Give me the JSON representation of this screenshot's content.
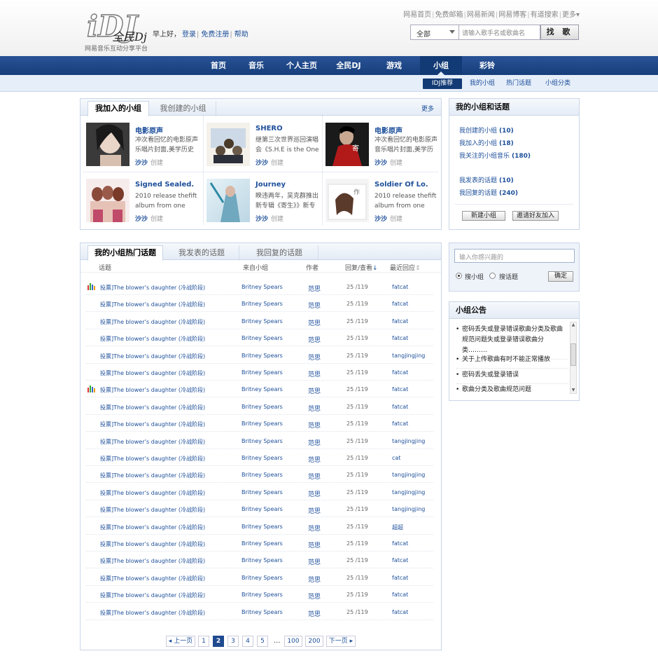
{
  "header": {
    "logo_text": "全民Dj",
    "logo_sub": "网易音乐互动分享平台",
    "greeting": "早上好，",
    "login": "登录",
    "register": "免费注册",
    "help": "帮助",
    "top_links": [
      "网易首页",
      "免费邮箱",
      "网易新闻",
      "网易博客",
      "有道搜索",
      "更多▾"
    ]
  },
  "search": {
    "category": "全部",
    "placeholder": "请输入歌手名或歌曲名",
    "button": "找 歌"
  },
  "nav": {
    "items": [
      "首页",
      "音乐",
      "个人主页",
      "全民DJ",
      "游戏",
      "小组",
      "彩铃"
    ],
    "active": "小组"
  },
  "subnav": {
    "items": [
      "IDJ推荐",
      "我的小组",
      "热门话题",
      "小组分类"
    ]
  },
  "my_groups": {
    "tabs": [
      "我加入的小组",
      "我创建的小组"
    ],
    "more": "更多",
    "groups": [
      {
        "title": "电影原声",
        "desc": "冲次看回忆的电影原声乐唱片封面,美学历史",
        "author": "沙沙",
        "created": "创建"
      },
      {
        "title": "SHERO",
        "desc": "继第三次世界巡回演唱会《S.H.E is the One",
        "author": "沙沙",
        "created": "创建"
      },
      {
        "title": "电影原声",
        "desc": "冲次看回忆的电影原声音乐唱片封面,美学历史",
        "author": "沙沙",
        "created": "创建"
      },
      {
        "title": "Signed Sealed.",
        "desc": "2010 release thefift album from one",
        "author": "沙沙",
        "created": "创建"
      },
      {
        "title": "Journey",
        "desc": "睽违两年，吴克群推出新专辑《寄生》》新专",
        "author": "沙沙",
        "created": "创建"
      },
      {
        "title": "Soldier Of Lo.",
        "desc": "2010 release thefift album from one",
        "author": "沙沙",
        "created": "创建"
      }
    ]
  },
  "side_box": {
    "title": "我的小组和话题",
    "links": [
      {
        "label": "我创建的小组",
        "count": "(10)"
      },
      {
        "label": "我加入的小组",
        "count": "(18)"
      },
      {
        "label": "我关注的小组音乐",
        "count": "(180)"
      },
      {
        "label": "我发表的话题",
        "count": "(10)"
      },
      {
        "label": "我回复的话题",
        "count": "(240)"
      }
    ],
    "btn_new": "新建小组",
    "btn_invite": "邀请好友加入"
  },
  "topics": {
    "tabs": [
      "我的小组热门话题",
      "我发表的话题",
      "我回复的话题"
    ],
    "headers": {
      "topic": "话题",
      "from": "来自小组",
      "author": "作者",
      "reply": "回复/查看",
      "last": "最近回应"
    },
    "rows": [
      {
        "hot": true,
        "topic": "投票]The blower’s daughter (冷战阶段)",
        "from": "Britney Spears",
        "author": "范思",
        "rv": "25 /119",
        "last": "fatcat"
      },
      {
        "hot": false,
        "topic": "投票]The blower’s daughter (冷战阶段)",
        "from": "Britney Spears",
        "author": "范思",
        "rv": "25 /119",
        "last": "fatcat"
      },
      {
        "hot": false,
        "topic": "投票]The blower’s daughter (冷战阶段)",
        "from": "Britney Spears",
        "author": "范思",
        "rv": "25 /119",
        "last": "fatcat"
      },
      {
        "hot": false,
        "topic": "投票]The blower’s daughter (冷战阶段)",
        "from": "Britney Spears",
        "author": "范思",
        "rv": "25 /119",
        "last": "fatcat"
      },
      {
        "hot": false,
        "topic": "投票]The blower’s daughter (冷战阶段)",
        "from": "Britney Spears",
        "author": "范思",
        "rv": "25 /119",
        "last": "tangjingjing"
      },
      {
        "hot": false,
        "topic": "投票]The blower’s daughter (冷战阶段)",
        "from": "Britney Spears",
        "author": "范思",
        "rv": "25 /119",
        "last": "fatcat"
      },
      {
        "hot": true,
        "topic": "投票]The blower’s daughter (冷战阶段)",
        "from": "Britney Spears",
        "author": "范思",
        "rv": "25 /119",
        "last": "fatcat"
      },
      {
        "hot": false,
        "topic": "投票]The blower’s daughter (冷战阶段)",
        "from": "Britney Spears",
        "author": "范思",
        "rv": "25 /119",
        "last": "fatcat"
      },
      {
        "hot": false,
        "topic": "投票]The blower’s daughter (冷战阶段)",
        "from": "Britney Spears",
        "author": "范思",
        "rv": "25 /119",
        "last": "fatcat"
      },
      {
        "hot": false,
        "topic": "投票]The blower’s daughter (冷战阶段)",
        "from": "Britney Spears",
        "author": "范思",
        "rv": "25 /119",
        "last": "tangjingjing"
      },
      {
        "hot": false,
        "topic": "投票]The blower’s daughter (冷战阶段)",
        "from": "Britney Spears",
        "author": "范思",
        "rv": "25 /119",
        "last": "cat"
      },
      {
        "hot": false,
        "topic": "投票]The blower’s daughter (冷战阶段)",
        "from": "Britney Spears",
        "author": "范思",
        "rv": "25 /119",
        "last": "tangjingjing"
      },
      {
        "hot": false,
        "topic": "投票]The blower’s daughter (冷战阶段)",
        "from": "Britney Spears",
        "author": "范思",
        "rv": "25 /119",
        "last": "tangjingjing"
      },
      {
        "hot": false,
        "topic": "投票]The blower’s daughter (冷战阶段)",
        "from": "Britney Spears",
        "author": "范思",
        "rv": "25 /119",
        "last": "tangjingjing"
      },
      {
        "hot": false,
        "topic": "投票]The blower’s daughter (冷战阶段)",
        "from": "Britney Spears",
        "author": "范思",
        "rv": "25 /119",
        "last": "超超"
      },
      {
        "hot": false,
        "topic": "投票]The blower’s daughter (冷战阶段)",
        "from": "Britney Spears",
        "author": "范思",
        "rv": "25 /119",
        "last": "fatcat"
      },
      {
        "hot": false,
        "topic": "投票]The blower’s daughter (冷战阶段)",
        "from": "Britney Spears",
        "author": "范思",
        "rv": "25 /119",
        "last": "fatcat"
      },
      {
        "hot": false,
        "topic": "投票]The blower’s daughter (冷战阶段)",
        "from": "Britney Spears",
        "author": "范思",
        "rv": "25 /119",
        "last": "fatcat"
      },
      {
        "hot": false,
        "topic": "投票]The blower’s daughter (冷战阶段)",
        "from": "Britney Spears",
        "author": "范思",
        "rv": "25 /119",
        "last": "fatcat"
      },
      {
        "hot": false,
        "topic": "投票]The blower’s daughter (冷战阶段)",
        "from": "Britney Spears",
        "author": "范思",
        "rv": "25 /119",
        "last": "fatcat"
      }
    ]
  },
  "pager": {
    "prev": "◂ 上一页",
    "pages": [
      "1",
      "2",
      "3",
      "4",
      "5"
    ],
    "current": "2",
    "ellipsis": "...",
    "far": [
      "100",
      "200"
    ],
    "next": "下一页 ▸"
  },
  "group_search": {
    "placeholder": "输入你感兴趣的",
    "opt_group": "搜小组",
    "opt_topic": "搜话题",
    "button": "确定"
  },
  "notice": {
    "title": "小组公告",
    "items": [
      "密码丢失或登录错误歌曲分类及歌曲规范问题失或登录错误歌曲分类………",
      "关于上传歌曲有时不能正常播放",
      "密码丢失或登录错误",
      "歌曲分类及歌曲规范问题"
    ]
  },
  "colors": {
    "brand": "#1d4f9a",
    "nav": "#1f4a8f",
    "panel_border": "#c9d6e6"
  }
}
